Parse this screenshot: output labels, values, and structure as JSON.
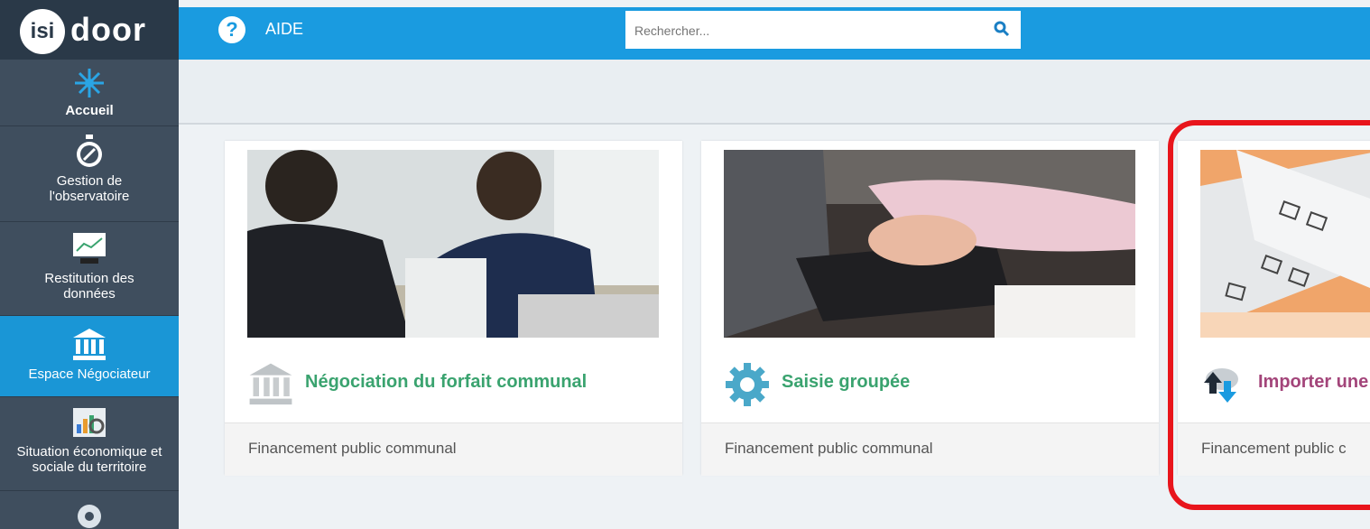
{
  "brand": {
    "logo_left": "isi",
    "logo_right": "door"
  },
  "sidebar": {
    "items": [
      {
        "label": "Accueil",
        "icon": "compass-star-icon"
      },
      {
        "label": "Gestion de l'observatoire",
        "icon": "stopwatch-icon"
      },
      {
        "label": "Restitution des données",
        "icon": "chart-board-icon"
      },
      {
        "label": "Espace Négociateur",
        "icon": "bank-icon"
      },
      {
        "label": "Situation économique et sociale du territoire",
        "icon": "search-chart-icon"
      },
      {
        "label": "",
        "icon": "gear-icon"
      }
    ]
  },
  "topbar": {
    "help_glyph": "?",
    "help_label": "AIDE",
    "search_placeholder": "Rechercher..."
  },
  "cards": [
    {
      "title": "Négociation du forfait communal",
      "subtitle": "Financement public communal",
      "icon": "bank-icon",
      "title_color": "#3aa36f"
    },
    {
      "title": "Saisie groupée",
      "subtitle": "Financement public communal",
      "icon": "gear-icon",
      "title_color": "#3aa36f"
    },
    {
      "title": "Importer une",
      "subtitle": "Financement public c",
      "icon": "cloud-upload-download-icon",
      "title_color": "#a3457a"
    }
  ],
  "colors": {
    "topbar": "#1a9be0",
    "sidebar": "#3f4e5e",
    "active": "#1a96d6",
    "highlight": "#e8151c"
  }
}
